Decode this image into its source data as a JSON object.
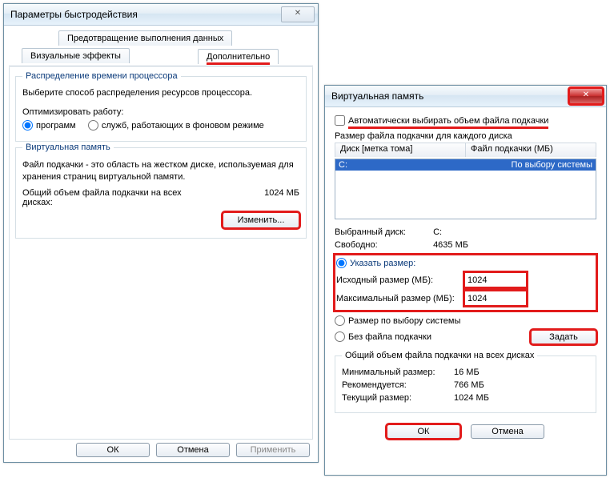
{
  "perf": {
    "title": "Параметры быстродействия",
    "tab_dep": "Предотвращение выполнения данных",
    "tab_vis": "Визуальные эффекты",
    "tab_adv": "Дополнительно",
    "sched": {
      "legend": "Распределение времени процессора",
      "desc": "Выберите способ распределения ресурсов процессора.",
      "opt_label": "Оптимизировать работу:",
      "opt_prog": "программ",
      "opt_srv": "служб, работающих в фоновом режиме"
    },
    "vm": {
      "legend": "Виртуальная память",
      "desc": "Файл подкачки - это область на жестком диске, используемая для хранения страниц виртуальной памяти.",
      "total_label": "Общий объем файла подкачки на всех дисках:",
      "total_value": "1024 МБ",
      "change": "Изменить..."
    },
    "ok": "ОК",
    "cancel": "Отмена",
    "apply": "Применить"
  },
  "vmdlg": {
    "title": "Виртуальная память",
    "auto": "Автоматически выбирать объем файла подкачки",
    "per_drive": "Размер файла подкачки для каждого диска",
    "col_drive": "Диск [метка тома]",
    "col_pf": "Файл подкачки (МБ)",
    "sel_drv": "C:",
    "sel_pf": "По выбору системы",
    "seldrive_label": "Выбранный диск:",
    "seldrive_val": "C:",
    "free_label": "Свободно:",
    "free_val": "4635 МБ",
    "opt_custom": "Указать размер:",
    "init_label": "Исходный размер (МБ):",
    "init_val": "1024",
    "max_label": "Максимальный размер (МБ):",
    "max_val": "1024",
    "opt_sys": "Размер по выбору системы",
    "opt_none": "Без файла подкачки",
    "set": "Задать",
    "totals": {
      "legend": "Общий объем файла подкачки на всех дисках",
      "min_l": "Минимальный размер:",
      "min_v": "16 МБ",
      "rec_l": "Рекомендуется:",
      "rec_v": "766 МБ",
      "cur_l": "Текущий размер:",
      "cur_v": "1024 МБ"
    },
    "ok": "ОК",
    "cancel": "Отмена"
  }
}
